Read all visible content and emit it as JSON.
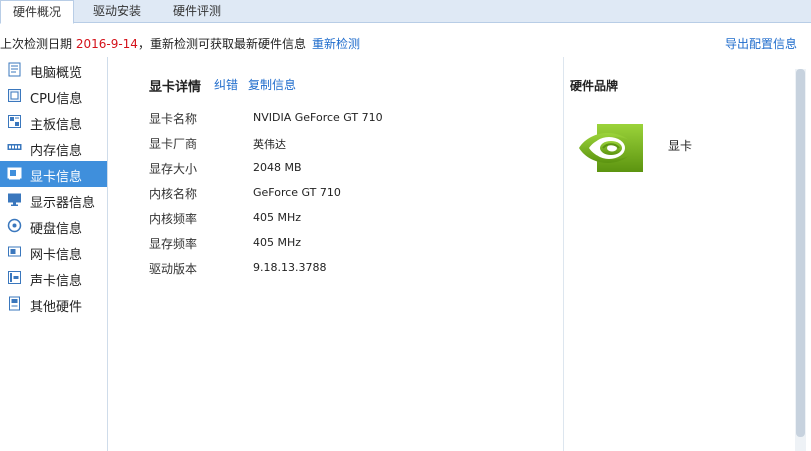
{
  "tabs": [
    {
      "label": "硬件概况",
      "active": true
    },
    {
      "label": "驱动安装",
      "active": false
    },
    {
      "label": "硬件评测",
      "active": false
    }
  ],
  "infobar": {
    "prefix": "上次检测日期 ",
    "date": "2016-9-14",
    "suffix": "，重新检测可获取最新硬件信息",
    "recheck_label": "重新检测",
    "export_label": "导出配置信息"
  },
  "sidebar": {
    "items": [
      {
        "label": "电脑概览",
        "icon": "computer-overview-icon"
      },
      {
        "label": "CPU信息",
        "icon": "cpu-icon"
      },
      {
        "label": "主板信息",
        "icon": "motherboard-icon"
      },
      {
        "label": "内存信息",
        "icon": "memory-icon"
      },
      {
        "label": "显卡信息",
        "icon": "graphics-card-icon",
        "active": true
      },
      {
        "label": "显示器信息",
        "icon": "monitor-icon"
      },
      {
        "label": "硬盘信息",
        "icon": "hard-disk-icon"
      },
      {
        "label": "网卡信息",
        "icon": "network-card-icon"
      },
      {
        "label": "声卡信息",
        "icon": "sound-card-icon"
      },
      {
        "label": "其他硬件",
        "icon": "other-hardware-icon"
      }
    ]
  },
  "details": {
    "title": "显卡详情",
    "correct_label": "纠错",
    "copy_label": "复制信息",
    "rows": [
      {
        "key": "显卡名称",
        "value": "NVIDIA GeForce GT 710"
      },
      {
        "key": "显卡厂商",
        "value": "英伟达"
      },
      {
        "key": "显存大小",
        "value": "2048 MB"
      },
      {
        "key": "内核名称",
        "value": "GeForce GT 710"
      },
      {
        "key": "内核频率",
        "value": "405 MHz"
      },
      {
        "key": "显存频率",
        "value": "405 MHz"
      },
      {
        "key": "驱动版本",
        "value": "9.18.13.3788"
      }
    ]
  },
  "brand": {
    "title": "硬件品牌",
    "logo_icon": "nvidia-logo-icon",
    "name": "显卡"
  },
  "colors": {
    "accent": "#3f8fdc",
    "link": "#1f6ccc",
    "date_red": "#d4121a",
    "nvidia_green": "#76b900"
  }
}
